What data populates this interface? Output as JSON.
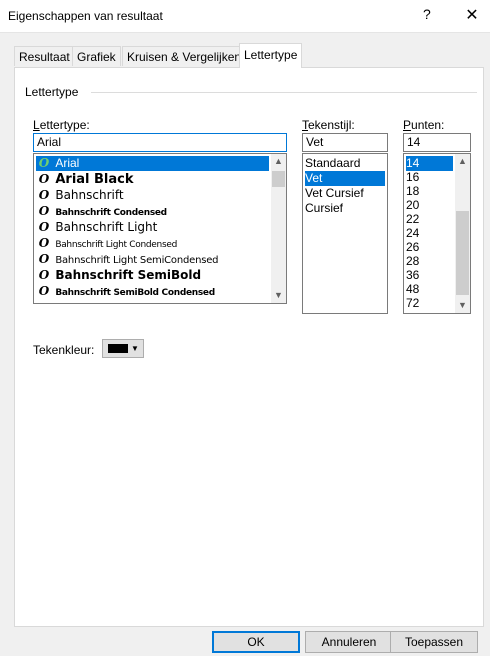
{
  "window": {
    "title": "Eigenschappen van resultaat",
    "help": "?",
    "close": "✕"
  },
  "tabs": [
    {
      "label": "Resultaat"
    },
    {
      "label": "Grafiek"
    },
    {
      "label": "Kruisen & Vergelijken"
    },
    {
      "label": "Lettertype"
    }
  ],
  "active_tab": "Lettertype",
  "group": {
    "label": "Lettertype"
  },
  "font": {
    "label_u": "L",
    "label_rest": "ettertype:",
    "value": "Arial",
    "items": [
      {
        "name": "Arial",
        "selected": true
      },
      {
        "name": "Arial Black"
      },
      {
        "name": "Bahnschrift"
      },
      {
        "name": "Bahnschrift Condensed"
      },
      {
        "name": "Bahnschrift Light"
      },
      {
        "name": "Bahnschrift Light Condensed"
      },
      {
        "name": "Bahnschrift Light SemiCondensed"
      },
      {
        "name": "Bahnschrift SemiBold"
      },
      {
        "name": "Bahnschrift SemiBold Condensed"
      }
    ]
  },
  "style": {
    "label_u": "T",
    "label_rest": "ekenstijl:",
    "value": "Vet",
    "items": [
      {
        "name": "Standaard"
      },
      {
        "name": "Vet",
        "selected": true
      },
      {
        "name": "Vet Cursief"
      },
      {
        "name": "Cursief"
      }
    ]
  },
  "size": {
    "label_u": "P",
    "label_rest": "unten:",
    "value": "14",
    "items": [
      {
        "name": "14",
        "selected": true
      },
      {
        "name": "16"
      },
      {
        "name": "18"
      },
      {
        "name": "20"
      },
      {
        "name": "22"
      },
      {
        "name": "24"
      },
      {
        "name": "26"
      },
      {
        "name": "28"
      },
      {
        "name": "36"
      },
      {
        "name": "48"
      },
      {
        "name": "72"
      }
    ]
  },
  "color": {
    "label": "Tekenkleur:",
    "value_hex": "#000000"
  },
  "buttons": {
    "ok": "OK",
    "cancel": "Annuleren",
    "apply": "Toepassen"
  },
  "colors": {
    "accent": "#0078d7",
    "selection_text": "#ffffff"
  }
}
